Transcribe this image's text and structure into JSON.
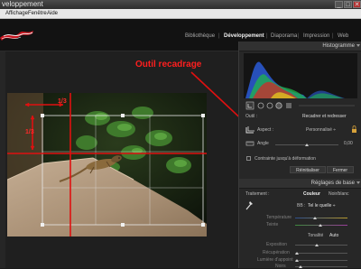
{
  "window": {
    "title": "veloppement",
    "min": "_",
    "max": "□",
    "close": "✕"
  },
  "menu": {
    "items": [
      "Affichage",
      "Fenêtre",
      "Aide"
    ]
  },
  "header": {
    "nav": [
      "Bibliothèque",
      "Développement",
      "Diaporama",
      "Impression",
      "Web"
    ],
    "sep": "|"
  },
  "annotations": {
    "callout": "Outil recadrage",
    "top_ratio": "1/3",
    "left_ratio": "1/3"
  },
  "panels": {
    "histogram": {
      "title": "Histogramme"
    },
    "crop": {
      "tool_label": "Outil :",
      "tool_title": "Recadrer et redresser",
      "aspect_label": "Aspect :",
      "aspect_value": "Personnalisé ÷",
      "angle_label": "Angle",
      "angle_value": "0,00",
      "constrain_label": "Contrainte jusqu'à déformation",
      "reset": "Réinitialiser",
      "close": "Fermer"
    },
    "basic": {
      "title": "Réglages de base",
      "treatment_label": "Traitement :",
      "color": "Couleur",
      "bw": "Noir/blanc",
      "wb_label": "BB :",
      "wb_value": "Tel le quelle ÷",
      "temp_label": "Température",
      "tint_label": "Teinte",
      "tone_label": "Tonalité",
      "auto": "Auto",
      "exposure_label": "Exposition",
      "recovery_label": "Récupération",
      "fill_label": "Lumière d'appoint",
      "blacks_label": "Noirs"
    }
  },
  "colors": {
    "accent": "#ff1f1f",
    "guide": "#e01010",
    "panel_bg": "#272727"
  }
}
